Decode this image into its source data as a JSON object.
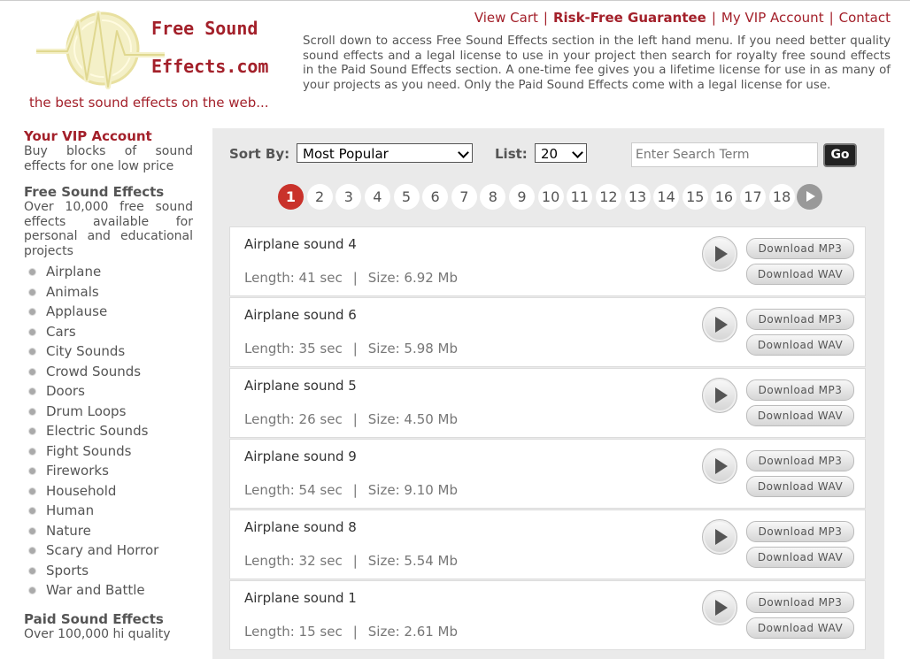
{
  "logo": {
    "line1": "Free Sound",
    "line2": "Effects.com",
    "tagline": "the best sound effects on the web..."
  },
  "topnav": {
    "view_cart": "View Cart",
    "guarantee": "Risk-Free Guarantee",
    "vip_account": "My VIP Account",
    "contact": "Contact",
    "separator": "|"
  },
  "intro": "Scroll down to access Free Sound Effects section in the left hand menu. If you need better quality sound effects and a legal license to use in your project then search for royalty free sound effects in the Paid Sound Effects section. A one-time fee gives you a lifetime license for use in as many of your projects as you need. Only the Paid Sound Effects come with a legal license for use.",
  "sidebar": {
    "vip": {
      "title": "Your VIP Account",
      "text": "Buy blocks of sound effects for one low price"
    },
    "free": {
      "title": "Free Sound Effects",
      "text": "Over 10,000 free sound effects available for personal and educational projects"
    },
    "categories": [
      "Airplane",
      "Animals",
      "Applause",
      "Cars",
      "City Sounds",
      "Crowd Sounds",
      "Doors",
      "Drum Loops",
      "Electric Sounds",
      "Fight Sounds",
      "Fireworks",
      "Household",
      "Human",
      "Nature",
      "Scary and Horror",
      "Sports",
      "War and Battle"
    ],
    "paid": {
      "title": "Paid Sound Effects",
      "text": "Over 100,000 hi quality"
    }
  },
  "controls": {
    "sort_label": "Sort By:",
    "sort_value": "Most Popular",
    "list_label": "List:",
    "list_value": "20",
    "search_placeholder": "Enter Search Term",
    "go_label": "Go"
  },
  "pager": {
    "pages": [
      "1",
      "2",
      "3",
      "4",
      "5",
      "6",
      "7",
      "8",
      "9",
      "10",
      "11",
      "12",
      "13",
      "14",
      "15",
      "16",
      "17",
      "18"
    ],
    "active": "1"
  },
  "sounds": [
    {
      "name": "Airplane sound 4",
      "length": "Length: 41 sec",
      "size": "Size: 6.92 Mb"
    },
    {
      "name": "Airplane sound 6",
      "length": "Length: 35 sec",
      "size": "Size: 5.98 Mb"
    },
    {
      "name": "Airplane sound 5",
      "length": "Length: 26 sec",
      "size": "Size: 4.50 Mb"
    },
    {
      "name": "Airplane sound 9",
      "length": "Length: 54 sec",
      "size": "Size: 9.10 Mb"
    },
    {
      "name": "Airplane sound 8",
      "length": "Length: 32 sec",
      "size": "Size: 5.54 Mb"
    },
    {
      "name": "Airplane sound 1",
      "length": "Length: 15 sec",
      "size": "Size: 2.61 Mb"
    }
  ],
  "buttons": {
    "mp3": "Download MP3",
    "wav": "Download WAV"
  },
  "colors": {
    "accent": "#a3202a",
    "active_page": "#c9322b",
    "panel": "#eaeaea"
  }
}
